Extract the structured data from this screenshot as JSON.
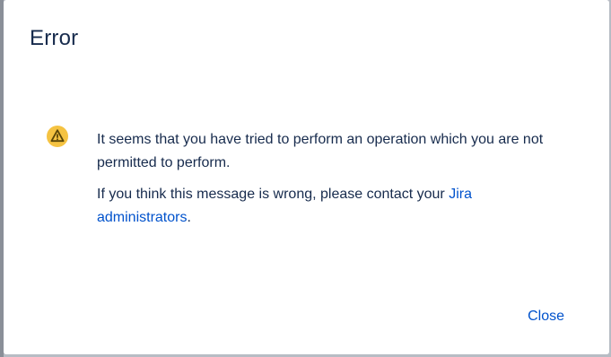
{
  "dialog": {
    "title": "Error",
    "icon": "warning-icon",
    "message_line1": "It seems that you have tried to perform an operation which you are not permitted to perform.",
    "message_line2_prefix": "If you think this message is wrong, please contact your ",
    "message_line2_link": "Jira administrators",
    "message_line2_suffix": ".",
    "close_label": "Close"
  },
  "colors": {
    "title_text": "#172b4d",
    "link": "#0052cc",
    "warning_fill": "#f5c342",
    "warning_glyph": "#5a4608"
  }
}
